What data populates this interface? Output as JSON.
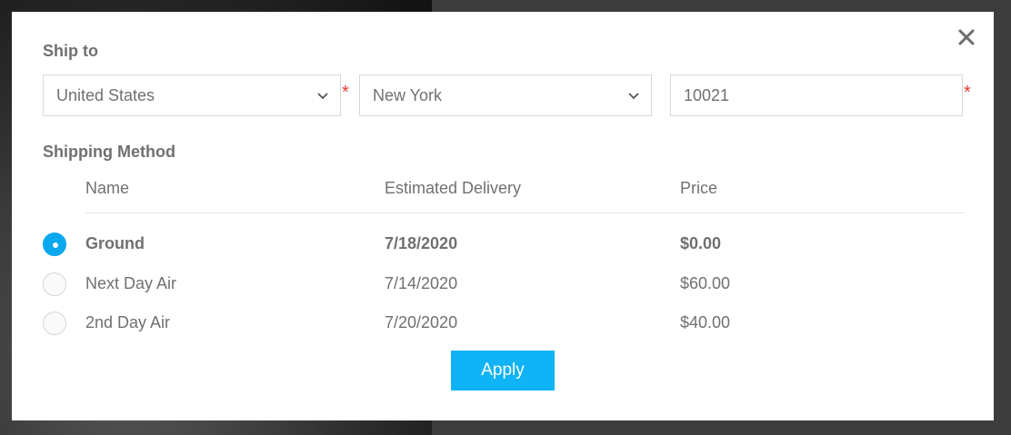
{
  "shipping": {
    "ship_to_title": "Ship to",
    "country": {
      "value": "United States",
      "required_mark": "*"
    },
    "state": {
      "value": "New York"
    },
    "zip": {
      "value": "10021",
      "required_mark": "*"
    }
  },
  "method": {
    "title": "Shipping Method",
    "columns": [
      "Name",
      "Estimated Delivery",
      "Price"
    ],
    "options": [
      {
        "name": "Ground",
        "delivery": "7/18/2020",
        "price": "$0.00",
        "selected": true
      },
      {
        "name": "Next Day Air",
        "delivery": "7/14/2020",
        "price": "$60.00",
        "selected": false
      },
      {
        "name": "2nd Day Air",
        "delivery": "7/20/2020",
        "price": "$40.00",
        "selected": false
      }
    ]
  },
  "actions": {
    "apply_label": "Apply"
  },
  "icons": {
    "close": "close-icon",
    "dropdown": "chevron-down-icon",
    "radio": "radio-icon"
  },
  "colors": {
    "accent": "#10b3f5",
    "required": "#e53935",
    "text": "#707070"
  }
}
